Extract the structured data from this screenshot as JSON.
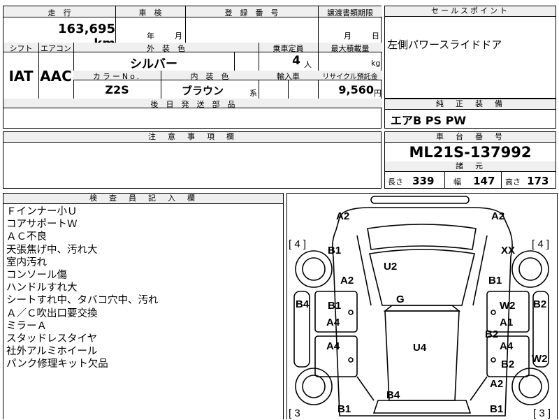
{
  "main": {
    "mileage_header": "走　行",
    "shaken_header": "車　検",
    "reg_header": "登　録　番　号",
    "transfer_header": "譲渡書類期限",
    "mileage": "163,695",
    "mileage_unit": "km",
    "year_unit": "年",
    "month_unit": "月",
    "month_unit2": "月",
    "date_mark": "日",
    "shift_header": "シフト",
    "ac_header": "エアコン",
    "ext_color_header": "外　装　色",
    "capacity_header": "乗車定員",
    "max_load_header": "最大積載量",
    "shift": "IAT",
    "ac": "AAC",
    "ext_color": "シルバー",
    "capacity": "4",
    "capacity_unit": "人",
    "load_unit": "kg",
    "color_no_header": "カラーNo.",
    "interior_header": "内　装　色",
    "import_header": "輸入車",
    "recycle_header": "リサイクル預託金",
    "color_no": "Z2S",
    "interior": "ブラウン",
    "interior_suffix": "系",
    "recycle_fee": "9,560",
    "yen_unit": "円",
    "later_parts_header": "後　日　発　送　部　品"
  },
  "notes": {
    "header": "注　意　事　項　欄"
  },
  "selling": {
    "header": "セールスポイント",
    "text": "左側パワースライドドア"
  },
  "equipment": {
    "header": "純　正　装　備",
    "text": "エアB  PS  PW"
  },
  "chassis": {
    "header": "車　台　番　号",
    "number": "ML21S-137992",
    "specs_header": "諸　元",
    "length_label": "長さ",
    "length": "339",
    "width_label": "幅",
    "width": "147",
    "height_label": "高さ",
    "height": "173"
  },
  "inspector": {
    "header": "検　査　員　記　入　欄",
    "lines": [
      "Ｆインナー小Ｕ",
      "コアサポートＷ",
      "ＡＣ不良",
      "天張焦げ中、汚れ大",
      "室内汚れ",
      "コンソール傷",
      "ハンドルすれ大",
      "シートすれ中、タバコ穴中、汚れ",
      "Ａ／Ｃ吹出口要交換",
      "ミラーＡ",
      "スタッドレスタイヤ",
      "社外アルミホイール",
      "パンク修理キット欠品"
    ]
  },
  "diagram": {
    "labels": {
      "front_left_a2": "A2",
      "front_right_a2": "A2",
      "tire_fl": "[ 4 ]",
      "tire_fr": "[ 4 ]",
      "fender_l_b1": "B1",
      "fender_r_xx": "XX",
      "roof_u2": "U2",
      "pillar_l_a2": "A2",
      "pillar_r_b1": "B1",
      "side_l_b4": "B4",
      "side_r_b2": "B2",
      "door_l_b1": "B1",
      "door_l_a4": "A4",
      "center_g": "G",
      "door_r_w2": "W2",
      "door_r_a1": "A1",
      "door_r_b2_mid": "B2",
      "door_l_a4_rear": "A4",
      "roof_rear_u4": "U4",
      "door_r_a4": "A4",
      "door_r_b2": "B2",
      "side_r_w2": "W2",
      "rear_r_a2": "A2",
      "rear_b4": "B4",
      "rear_l_b1": "B1",
      "rear_r_b1": "B1",
      "tire_rl": "[ 3",
      "tire_rr": "[ 3 ]"
    }
  }
}
